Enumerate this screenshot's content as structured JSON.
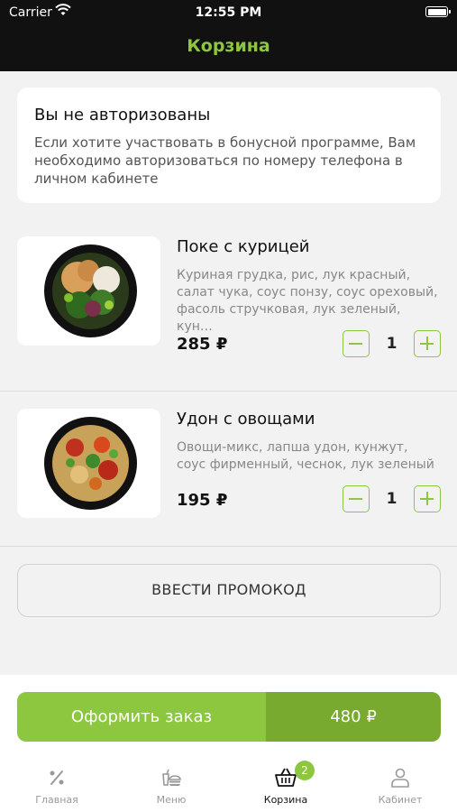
{
  "status_bar": {
    "carrier": "Carrier",
    "time": "12:55 PM"
  },
  "header": {
    "title": "Корзина"
  },
  "auth_notice": {
    "title": "Вы не авторизованы",
    "text": "Если хотите участвовать в бонусной программе, Вам необходимо авторизоваться по номеру телефона в личном кабинете"
  },
  "cart_items": [
    {
      "name": "Поке с курицей",
      "description": "Куриная грудка, рис,  лук красный, салат чука, соус понзу, соус ореховый, фасоль стручковая, лук зеленый, кун…",
      "price": "285 ₽",
      "quantity": "1"
    },
    {
      "name": "Удон с овощами",
      "description": "Овощи-микс, лапша удон, кунжут, соус фирменный, чеснок,  лук зеленый",
      "price": "195 ₽",
      "quantity": "1"
    }
  ],
  "promo_button": "ВВЕСТИ ПРОМОКОД",
  "checkout": {
    "label": "Оформить заказ",
    "total": "480 ₽"
  },
  "tab_bar": {
    "items": [
      {
        "label": "Главная",
        "icon": "percent-icon"
      },
      {
        "label": "Меню",
        "icon": "menu-burger-icon"
      },
      {
        "label": "Корзина",
        "icon": "basket-icon",
        "badge": "2"
      },
      {
        "label": "Кабинет",
        "icon": "profile-icon"
      }
    ]
  },
  "colors": {
    "accent": "#8dc63f",
    "accent_dark": "#78aa2f",
    "header_bg": "#111111"
  }
}
